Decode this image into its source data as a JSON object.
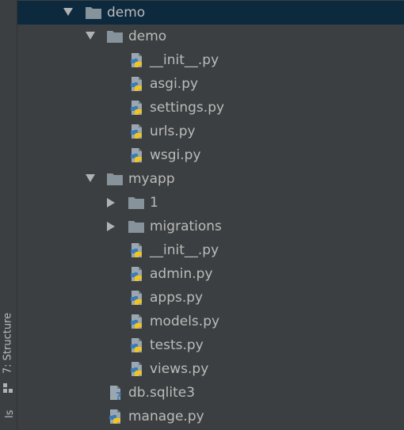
{
  "side_panel": {
    "structure_label": "7: Structure",
    "favorites_label": "ls"
  },
  "tree": {
    "root": "demo",
    "items": [
      {
        "label": "demo"
      },
      {
        "label": "__init__.py"
      },
      {
        "label": "asgi.py"
      },
      {
        "label": "settings.py"
      },
      {
        "label": "urls.py"
      },
      {
        "label": "wsgi.py"
      },
      {
        "label": "myapp"
      },
      {
        "label": "1"
      },
      {
        "label": "migrations"
      },
      {
        "label": "__init__.py"
      },
      {
        "label": "admin.py"
      },
      {
        "label": "apps.py"
      },
      {
        "label": "models.py"
      },
      {
        "label": "tests.py"
      },
      {
        "label": "views.py"
      },
      {
        "label": "db.sqlite3"
      },
      {
        "label": "manage.py"
      }
    ]
  },
  "colors": {
    "selection": "#0d293e",
    "background": "#3c3f41",
    "folder": "#87939a",
    "text": "#bbbbbb"
  },
  "icons": [
    "chevron-down-icon",
    "chevron-right-icon",
    "folder-icon",
    "python-file-icon",
    "unknown-file-icon"
  ]
}
